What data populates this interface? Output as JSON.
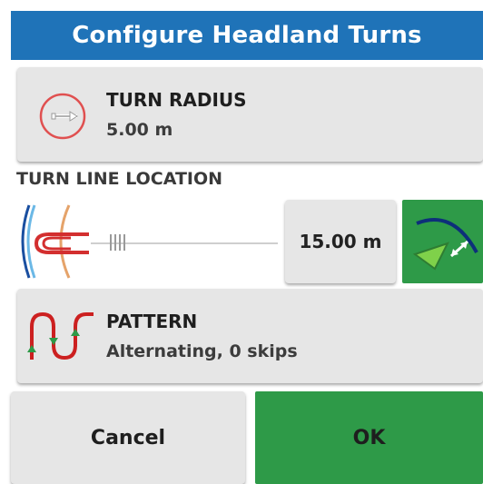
{
  "dialog": {
    "title": "Configure Headland Turns"
  },
  "turn_radius": {
    "label": "TURN RADIUS",
    "value": "5.00 m",
    "icon": "turn-radius-circle-icon"
  },
  "turn_line": {
    "heading": "TURN LINE LOCATION",
    "value": "15.00 m",
    "icon": "turn-line-location-icon",
    "toggle_icon": "turn-line-direction-toggle-icon",
    "slider_value": 0.3
  },
  "pattern": {
    "label": "PATTERN",
    "value": "Alternating, 0 skips",
    "icon": "alternating-pattern-icon"
  },
  "actions": {
    "cancel": "Cancel",
    "ok": "OK"
  },
  "colors": {
    "title_bg": "#1f73b8",
    "button_bg": "#e6e6e6",
    "accent_green": "#2e9a48",
    "icon_red": "#d32f2f"
  }
}
